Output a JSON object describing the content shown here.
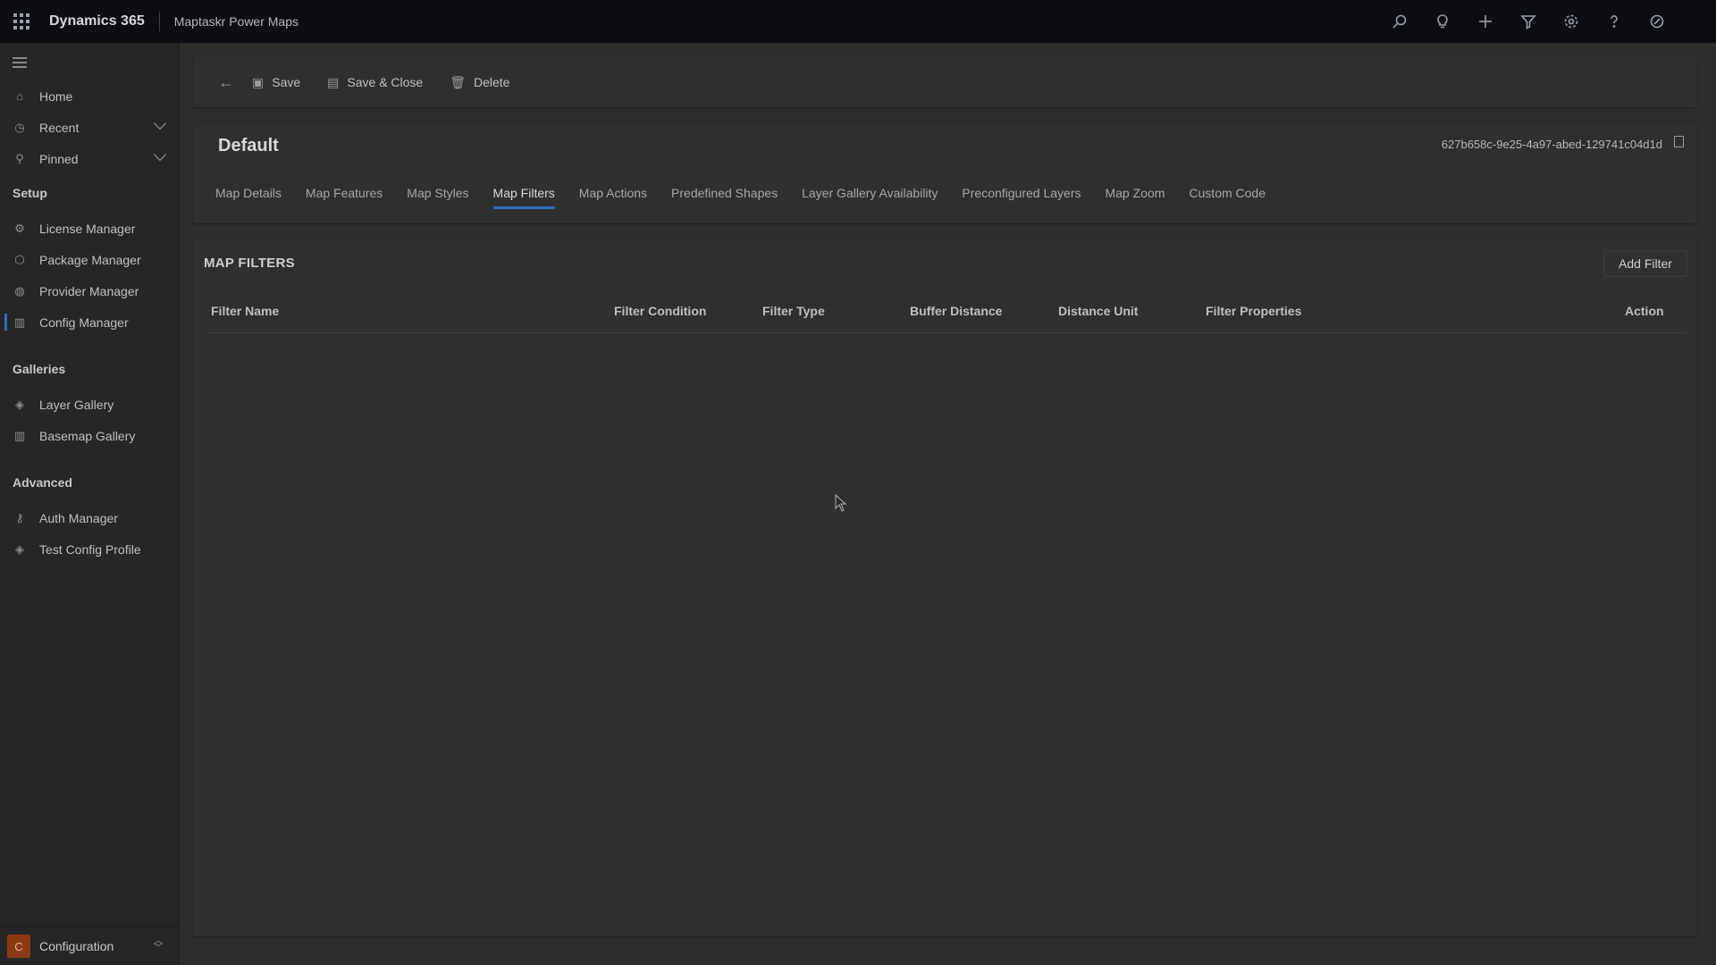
{
  "topbar": {
    "product": "Dynamics 365",
    "app_name": "Maptaskr Power Maps",
    "icons": [
      "search-icon",
      "lightbulb-icon",
      "plus-icon",
      "filter-icon",
      "gear-icon",
      "help-icon",
      "copilot-icon"
    ]
  },
  "sidebar": {
    "items_top": [
      {
        "label": "Home",
        "icon": "home-icon"
      },
      {
        "label": "Recent",
        "icon": "clock-icon",
        "expandable": true
      },
      {
        "label": "Pinned",
        "icon": "pin-icon",
        "expandable": true
      }
    ],
    "sections": [
      {
        "title": "Setup",
        "items": [
          {
            "label": "License Manager",
            "icon": "license-icon"
          },
          {
            "label": "Package Manager",
            "icon": "package-icon"
          },
          {
            "label": "Provider Manager",
            "icon": "globe-icon"
          },
          {
            "label": "Config Manager",
            "icon": "map-icon",
            "active": true
          }
        ]
      },
      {
        "title": "Galleries",
        "items": [
          {
            "label": "Layer Gallery",
            "icon": "layers-icon"
          },
          {
            "label": "Basemap Gallery",
            "icon": "map-icon"
          }
        ]
      },
      {
        "title": "Advanced",
        "items": [
          {
            "label": "Auth Manager",
            "icon": "key-icon"
          },
          {
            "label": "Test Config Profile",
            "icon": "layers-icon"
          }
        ]
      }
    ],
    "area": {
      "badge": "C",
      "label": "Configuration"
    }
  },
  "commandbar": {
    "save": "Save",
    "save_close": "Save & Close",
    "delete": "Delete"
  },
  "record": {
    "title": "Default",
    "id": "627b658c-9e25-4a97-abed-129741c04d1d",
    "tabs": [
      "Map Details",
      "Map Features",
      "Map Styles",
      "Map Filters",
      "Map Actions",
      "Predefined Shapes",
      "Layer Gallery Availability",
      "Preconfigured Layers",
      "Map Zoom",
      "Custom Code"
    ],
    "active_tab": "Map Filters"
  },
  "filters_section": {
    "title": "MAP FILTERS",
    "add_button": "Add Filter",
    "columns": [
      "Filter Name",
      "Filter Condition",
      "Filter Type",
      "Buffer Distance",
      "Distance Unit",
      "Filter Properties",
      "Action"
    ],
    "rows": []
  },
  "colors": {
    "accent": "#2f6fbd",
    "topbar": "#0c0e14",
    "area_badge": "#8a3a12"
  }
}
